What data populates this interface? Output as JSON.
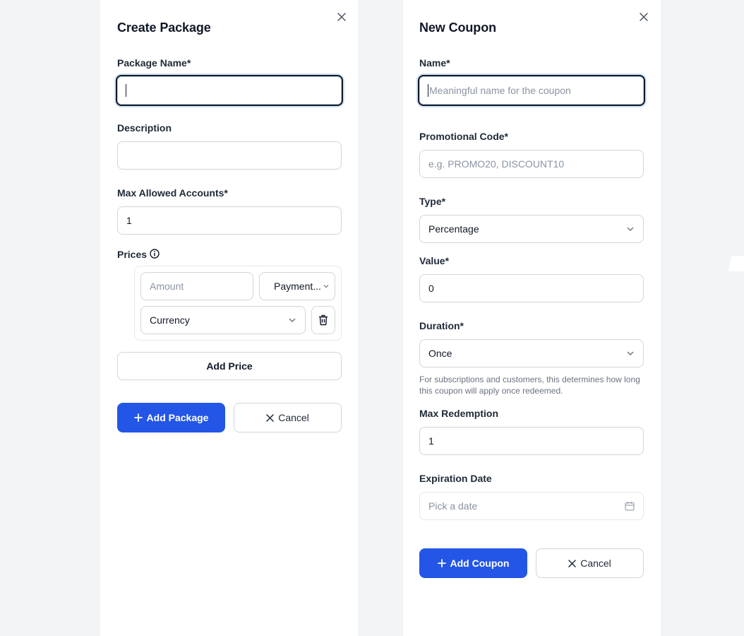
{
  "left_panel": {
    "title": "Create Package",
    "package_name_label": "Package Name*",
    "package_name_value": "",
    "description_label": "Description",
    "description_value": "",
    "max_accounts_label": "Max Allowed Accounts*",
    "max_accounts_value": "1",
    "prices_label": "Prices",
    "amount_placeholder": "Amount",
    "payment_select": "Payment...",
    "currency_select": "Currency",
    "add_price_label": "Add Price",
    "add_package_label": "Add Package",
    "cancel_label": "Cancel"
  },
  "right_panel": {
    "title": "New Coupon",
    "name_label": "Name*",
    "name_placeholder": "Meaningful name for the coupon",
    "promo_label": "Promotional Code*",
    "promo_placeholder": "e.g. PROMO20, DISCOUNT10",
    "type_label": "Type*",
    "type_value": "Percentage",
    "value_label": "Value*",
    "value_value": "0",
    "duration_label": "Duration*",
    "duration_value": "Once",
    "duration_helper": "For subscriptions and customers, this determines how long this coupon will apply once redeemed.",
    "max_redemption_label": "Max Redemption",
    "max_redemption_value": "1",
    "expiration_label": "Expiration Date",
    "expiration_placeholder": "Pick a date",
    "add_coupon_label": "Add Coupon",
    "cancel_label": "Cancel"
  },
  "colors": {
    "primary": "#2356e6",
    "background": "#f2f4f6",
    "panel": "#ffffff"
  },
  "icons": [
    "close-icon",
    "info-icon",
    "chevron-down-icon",
    "trash-icon",
    "plus-icon",
    "x-icon",
    "calendar-icon"
  ]
}
